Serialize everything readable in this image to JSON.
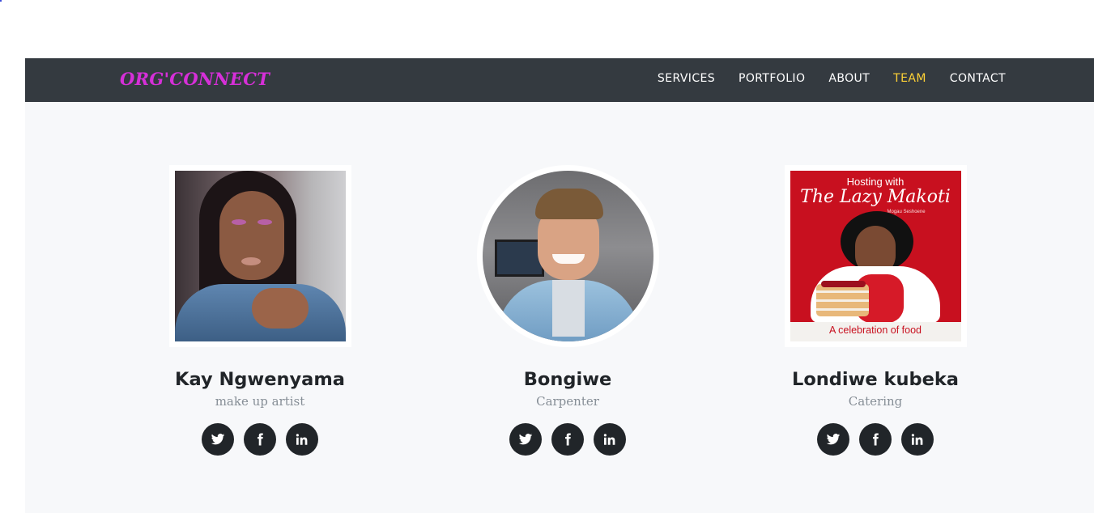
{
  "navbar": {
    "brand": "ORG'CONNECT",
    "links": [
      {
        "label": "SERVICES"
      },
      {
        "label": "PORTFOLIO"
      },
      {
        "label": "ABOUT"
      },
      {
        "label": "TEAM",
        "active": true
      },
      {
        "label": "CONTACT"
      }
    ],
    "active_color": "#fed136",
    "brand_color": "#d62fd8"
  },
  "team": {
    "members": [
      {
        "name": "Kay Ngwenyama",
        "role": "make up artist",
        "photo": "portrait-photo",
        "socials": [
          "twitter-icon",
          "facebook-icon",
          "linkedin-icon"
        ]
      },
      {
        "name": "Bongiwe",
        "role": "Carpenter",
        "photo": "portrait-photo",
        "socials": [
          "twitter-icon",
          "facebook-icon",
          "linkedin-icon"
        ]
      },
      {
        "name": "Londiwe kubeka",
        "role": "Catering",
        "photo": "book-cover-photo",
        "cover": {
          "line1": "Hosting with",
          "line2": "The Lazy Makoti",
          "author": "Mogau Seshoene",
          "tagline": "A celebration of food"
        },
        "socials": [
          "twitter-icon",
          "facebook-icon",
          "linkedin-icon"
        ]
      }
    ]
  }
}
